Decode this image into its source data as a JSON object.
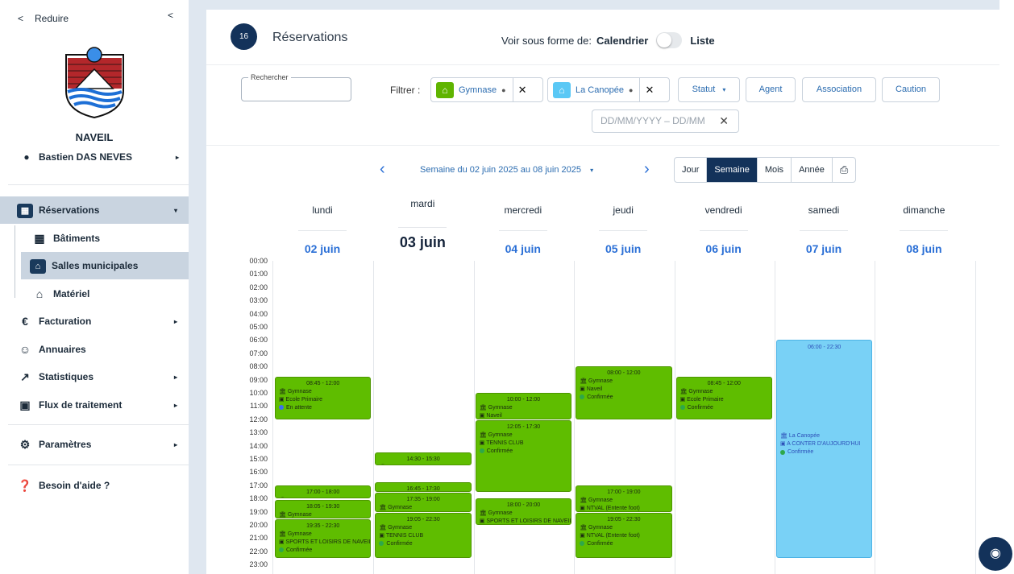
{
  "sidebar": {
    "reduire": "Reduire",
    "town": "NAVEIL",
    "user": "Bastien DAS NEVES",
    "items": [
      {
        "label": "Réservations"
      },
      {
        "label": "Bâtiments"
      },
      {
        "label": "Salles municipales"
      },
      {
        "label": "Matériel"
      },
      {
        "label": "Facturation"
      },
      {
        "label": "Annuaires"
      },
      {
        "label": "Statistiques"
      },
      {
        "label": "Flux de traitement"
      },
      {
        "label": "Paramètres"
      },
      {
        "label": "Besoin d'aide ?"
      }
    ]
  },
  "header": {
    "count": "16",
    "title": "Réservations",
    "view_prefix": "Voir sous forme de:",
    "view_cal": "Calendrier",
    "view_list": "Liste"
  },
  "filters": {
    "search_label": "Rechercher",
    "filtrer": "Filtrer :",
    "chip1": "Gymnase",
    "chip2": "La Canopée",
    "statut": "Statut",
    "agent": "Agent",
    "association": "Association",
    "caution": "Caution",
    "date_placeholder": "DD/MM/YYYY – DD/MM"
  },
  "week": {
    "label": "Semaine du 02 juin 2025 au 08 juin 2025",
    "views": [
      "Jour",
      "Semaine",
      "Mois",
      "Année"
    ]
  },
  "days": [
    {
      "name": "lundi",
      "date": "02 juin"
    },
    {
      "name": "mardi",
      "date": "03 juin"
    },
    {
      "name": "mercredi",
      "date": "04 juin"
    },
    {
      "name": "jeudi",
      "date": "05 juin"
    },
    {
      "name": "vendredi",
      "date": "06 juin"
    },
    {
      "name": "samedi",
      "date": "07 juin"
    },
    {
      "name": "dimanche",
      "date": "08 juin"
    }
  ],
  "hours": [
    "00:00",
    "01:00",
    "02:00",
    "03:00",
    "04:00",
    "05:00",
    "06:00",
    "07:00",
    "08:00",
    "09:00",
    "10:00",
    "11:00",
    "12:00",
    "13:00",
    "14:00",
    "15:00",
    "16:00",
    "17:00",
    "18:00",
    "19:00",
    "20:00",
    "21:00",
    "22:00",
    "23:00"
  ],
  "events": [
    {
      "day": 0,
      "start": 8.75,
      "end": 12.0,
      "time": "08:45 - 12:00",
      "room": "Gymnase",
      "who": "Ecole Primaire",
      "status": "En attente",
      "status_color": "#3b6ff0",
      "color": "green"
    },
    {
      "day": 0,
      "start": 17.0,
      "end": 18.0,
      "time": "17:00 - 18:00",
      "room": "Gymnase",
      "who": "TENNIS CLUB",
      "status": "",
      "status_color": "#2ea84a",
      "color": "green"
    },
    {
      "day": 0,
      "start": 18.08,
      "end": 19.5,
      "time": "18:05 - 19:30",
      "room": "Gymnase",
      "who": "NTVAL (Entente foot)",
      "status": "",
      "status_color": "#2ea84a",
      "color": "green"
    },
    {
      "day": 0,
      "start": 19.58,
      "end": 22.5,
      "time": "19:35 - 22:30",
      "room": "Gymnase",
      "who": "SPORTS ET LOISIRS DE NAVEIL",
      "status": "Confirmée",
      "status_color": "#2ea84a",
      "color": "green"
    },
    {
      "day": 1,
      "start": 14.5,
      "end": 15.5,
      "time": "14:30 - 15:30",
      "room": "Gymnase",
      "who": "IME Naveil",
      "status": "",
      "status_color": "#2ea84a",
      "color": "green"
    },
    {
      "day": 1,
      "start": 16.75,
      "end": 17.5,
      "time": "16:45 - 17:30",
      "room": "Gymnase",
      "who": "Naveil",
      "status": "",
      "status_color": "#2ea84a",
      "color": "green"
    },
    {
      "day": 1,
      "start": 17.58,
      "end": 19.0,
      "time": "17:35 - 19:00",
      "room": "Gymnase",
      "who": "NTVAL (Entente foot)",
      "status": "",
      "status_color": "#2ea84a",
      "color": "green"
    },
    {
      "day": 1,
      "start": 19.08,
      "end": 22.5,
      "time": "19:05 - 22:30",
      "room": "Gymnase",
      "who": "TENNIS CLUB",
      "status": "Confirmée",
      "status_color": "#2ea84a",
      "color": "green"
    },
    {
      "day": 2,
      "start": 10.0,
      "end": 12.0,
      "time": "10:00 - 12:00",
      "room": "Gymnase",
      "who": "Naveil",
      "status": "Confirmée",
      "status_color": "#2ea84a",
      "color": "green"
    },
    {
      "day": 2,
      "start": 12.08,
      "end": 17.5,
      "time": "12:05 - 17:30",
      "room": "Gymnase",
      "who": "TENNIS CLUB",
      "status": "Confirmée",
      "status_color": "#2ea84a",
      "color": "green"
    },
    {
      "day": 2,
      "start": 18.0,
      "end": 20.0,
      "time": "18:00 - 20:00",
      "room": "Gymnase",
      "who": "SPORTS ET LOISIRS DE NAVEIL",
      "status": "Confirmée",
      "status_color": "#2ea84a",
      "color": "green"
    },
    {
      "day": 3,
      "start": 8.0,
      "end": 12.0,
      "time": "08:00 - 12:00",
      "room": "Gymnase",
      "who": "Naveil",
      "status": "Confirmée",
      "status_color": "#2ea84a",
      "color": "green"
    },
    {
      "day": 3,
      "start": 17.0,
      "end": 19.0,
      "time": "17:00 - 19:00",
      "room": "Gymnase",
      "who": "NTVAL (Entente foot)",
      "status": "Confirmée",
      "status_color": "#2ea84a",
      "color": "green"
    },
    {
      "day": 3,
      "start": 19.08,
      "end": 22.5,
      "time": "19:05 - 22:30",
      "room": "Gymnase",
      "who": "NTVAL (Entente foot)",
      "status": "Confirmée",
      "status_color": "#2ea84a",
      "color": "green"
    },
    {
      "day": 4,
      "start": 8.75,
      "end": 12.0,
      "time": "08:45 - 12:00",
      "room": "Gymnase",
      "who": "Ecole Primaire",
      "status": "Confirmée",
      "status_color": "#2ea84a",
      "color": "green"
    },
    {
      "day": 5,
      "start": 6.0,
      "end": 22.5,
      "time": "06:00 - 22:30",
      "room": "La Canopée",
      "who": "A CONTER D'AUJOURD'HUI",
      "status": "Confirmée",
      "status_color": "#2ea84a",
      "color": "blue"
    }
  ]
}
